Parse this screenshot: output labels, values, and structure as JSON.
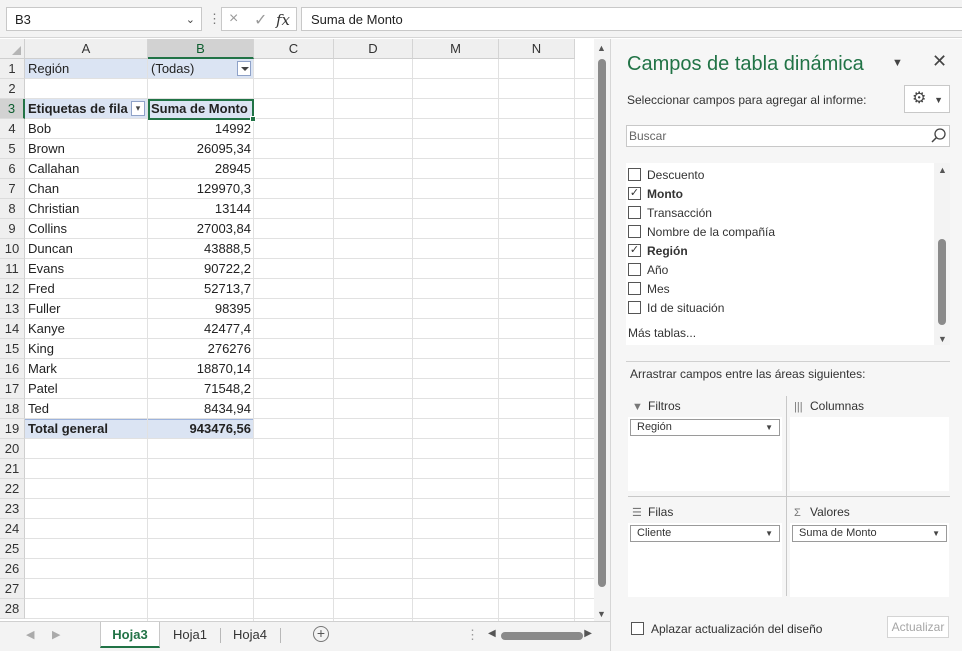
{
  "formula_bar": {
    "name_box": "B3",
    "separator": "⋮",
    "cancel_icon": "×",
    "enter_icon": "✓",
    "fx_label": "fx",
    "content": "Suma de Monto"
  },
  "sheet": {
    "columns": [
      "A",
      "B",
      "C",
      "D",
      "M",
      "N"
    ],
    "selected_column": "B",
    "row_numbers": [
      "1",
      "2",
      "3",
      "4",
      "5",
      "6",
      "7",
      "8",
      "9",
      "10",
      "11",
      "12",
      "13",
      "14",
      "15",
      "16",
      "17",
      "18",
      "19",
      "20",
      "21",
      "22",
      "23",
      "24",
      "25",
      "26",
      "27",
      "28"
    ],
    "selected_row": "3",
    "filter": {
      "label": "Región",
      "value": "(Todas)"
    },
    "pivot_header": {
      "row_label": "Etiquetas de fila",
      "value_label": "Suma de Monto"
    },
    "pivot_rows": [
      {
        "label": "Bob",
        "value": "14992"
      },
      {
        "label": "Brown",
        "value": "26095,34"
      },
      {
        "label": "Callahan",
        "value": "28945"
      },
      {
        "label": "Chan",
        "value": "129970,3"
      },
      {
        "label": "Christian",
        "value": "13144"
      },
      {
        "label": "Collins",
        "value": "27003,84"
      },
      {
        "label": "Duncan",
        "value": "43888,5"
      },
      {
        "label": "Evans",
        "value": "90722,2"
      },
      {
        "label": "Fred",
        "value": "52713,7"
      },
      {
        "label": "Fuller",
        "value": "98395"
      },
      {
        "label": "Kanye",
        "value": "42477,4"
      },
      {
        "label": "King",
        "value": "276276"
      },
      {
        "label": "Mark",
        "value": "18870,14"
      },
      {
        "label": "Patel",
        "value": "71548,2"
      },
      {
        "label": "Ted",
        "value": "8434,94"
      }
    ],
    "total": {
      "label": "Total general",
      "value": "943476,56"
    }
  },
  "tabs": {
    "sheets": [
      "Hoja3",
      "Hoja1",
      "Hoja4"
    ],
    "active": "Hoja3",
    "add_label": "+",
    "more_label": "⋮"
  },
  "pivot_pane": {
    "title": "Campos de tabla dinámica",
    "subtitle": "Seleccionar campos para agregar al informe:",
    "search_placeholder": "Buscar",
    "fields": [
      {
        "name": "Descuento",
        "checked": false
      },
      {
        "name": "Monto",
        "checked": true
      },
      {
        "name": "Transacción",
        "checked": false
      },
      {
        "name": "Nombre de la compañía",
        "checked": false
      },
      {
        "name": "Región",
        "checked": true
      },
      {
        "name": "Año",
        "checked": false
      },
      {
        "name": "Mes",
        "checked": false
      },
      {
        "name": "Id de situación",
        "checked": false
      }
    ],
    "more_tables": "Más tablas...",
    "drag_hint": "Arrastrar campos entre las áreas siguientes:",
    "areas": {
      "filters": {
        "label": "Filtros",
        "items": [
          "Región"
        ]
      },
      "columns": {
        "label": "Columnas",
        "items": []
      },
      "rows": {
        "label": "Filas",
        "items": [
          "Cliente"
        ]
      },
      "values": {
        "label": "Valores",
        "items": [
          "Suma de Monto"
        ]
      }
    },
    "defer_label": "Aplazar actualización del diseño",
    "update_button": "Actualizar"
  },
  "colors": {
    "accent": "#217346",
    "pivot_band": "#dbe4f3",
    "title_color": "#217346"
  }
}
